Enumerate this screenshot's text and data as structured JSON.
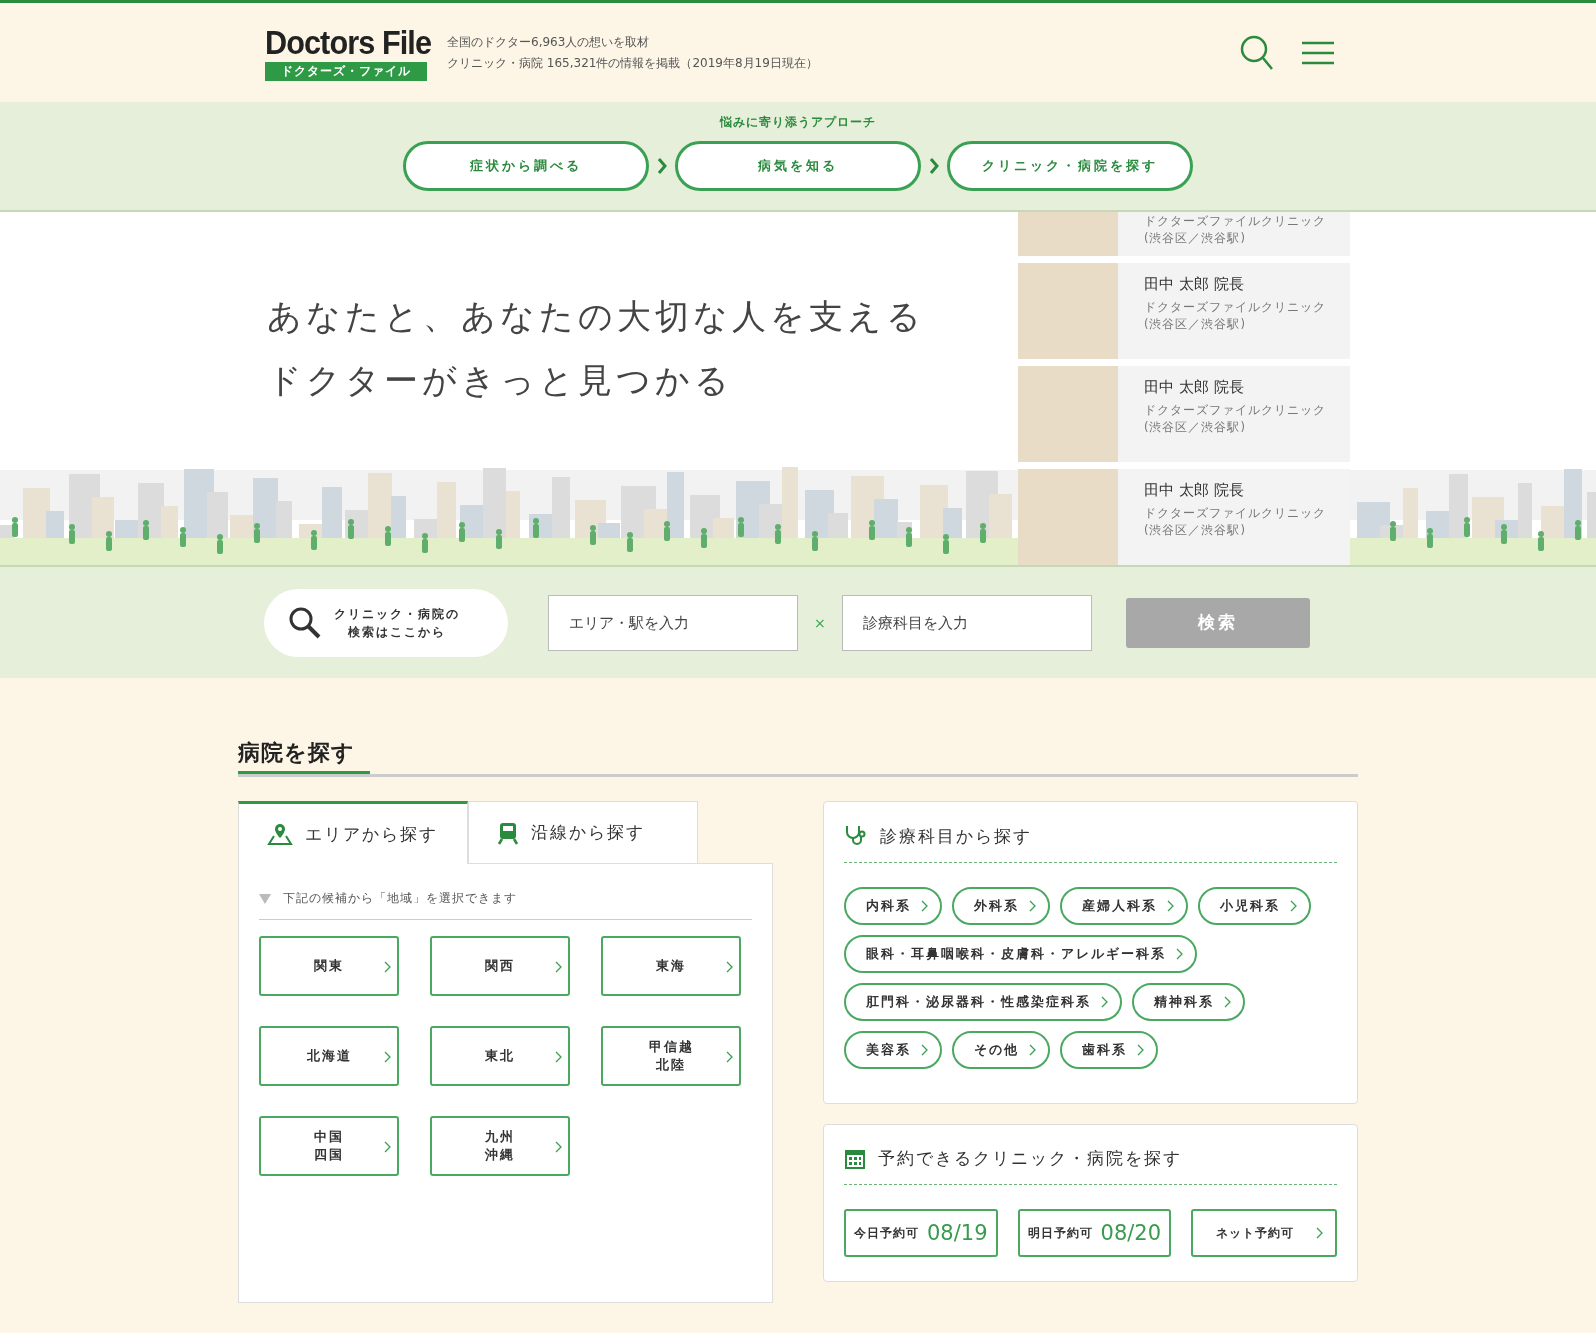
{
  "header": {
    "logo": "Doctors File",
    "logo_sub": "ドクターズ・ファイル",
    "stats": [
      "全国のドクター6,963人の想いを取材",
      "クリニック・病院 165,321件の情報を掲載（2019年8月19日現在）"
    ]
  },
  "approach": {
    "label": "悩みに寄り添うアプローチ",
    "steps": [
      "症状から調べる",
      "病気を知る",
      "クリニック・病院を探す"
    ]
  },
  "hero": {
    "headline": [
      "あなたと、あなたの大切な人を支える",
      "ドクターがきっと見つかる"
    ],
    "doctors": [
      {
        "clinic": "ドクターズファイルクリニック",
        "location": "(渋谷区／渋谷駅)"
      },
      {
        "name": "田中 太郎 院長",
        "clinic": "ドクターズファイルクリニック",
        "location": "(渋谷区／渋谷駅)"
      },
      {
        "name": "田中 太郎 院長",
        "clinic": "ドクターズファイルクリニック",
        "location": "(渋谷区／渋谷駅)"
      },
      {
        "name": "田中 太郎 院長",
        "clinic": "ドクターズファイルクリニック",
        "location": "(渋谷区／渋谷駅)"
      }
    ]
  },
  "search": {
    "bubble": "クリニック・病院の検索はここから",
    "area_placeholder": "エリア・駅を入力",
    "times": "×",
    "dept_placeholder": "診療科目を入力",
    "button": "検索"
  },
  "section": {
    "title": "病院を探す"
  },
  "area_panel": {
    "tabs": [
      {
        "label": "エリアから探す",
        "selected": true
      },
      {
        "label": "沿線から探す",
        "selected": false
      }
    ],
    "hint": "下記の候補から「地域」を選択できます",
    "regions": [
      "関東",
      "関西",
      "東海",
      "北海道",
      "東北",
      "甲信越北陸",
      "中国四国",
      "九州沖縄"
    ]
  },
  "dept_panel": {
    "title": "診療科目から探す",
    "departments": [
      "内科系",
      "外科系",
      "産婦人科系",
      "小児科系",
      "眼科・耳鼻咽喉科・皮膚科・アレルギー科系",
      "肛門科・泌尿器科・性感染症科系",
      "精神科系",
      "美容系",
      "その他",
      "歯科系"
    ]
  },
  "reserve_panel": {
    "title": "予約できるクリニック・病院を探す",
    "options": [
      {
        "kind": "date",
        "label": "今日予約可",
        "date": "08/19"
      },
      {
        "kind": "date",
        "label": "明日予約可",
        "date": "08/20"
      },
      {
        "kind": "link",
        "label": "ネット予約可"
      }
    ]
  }
}
